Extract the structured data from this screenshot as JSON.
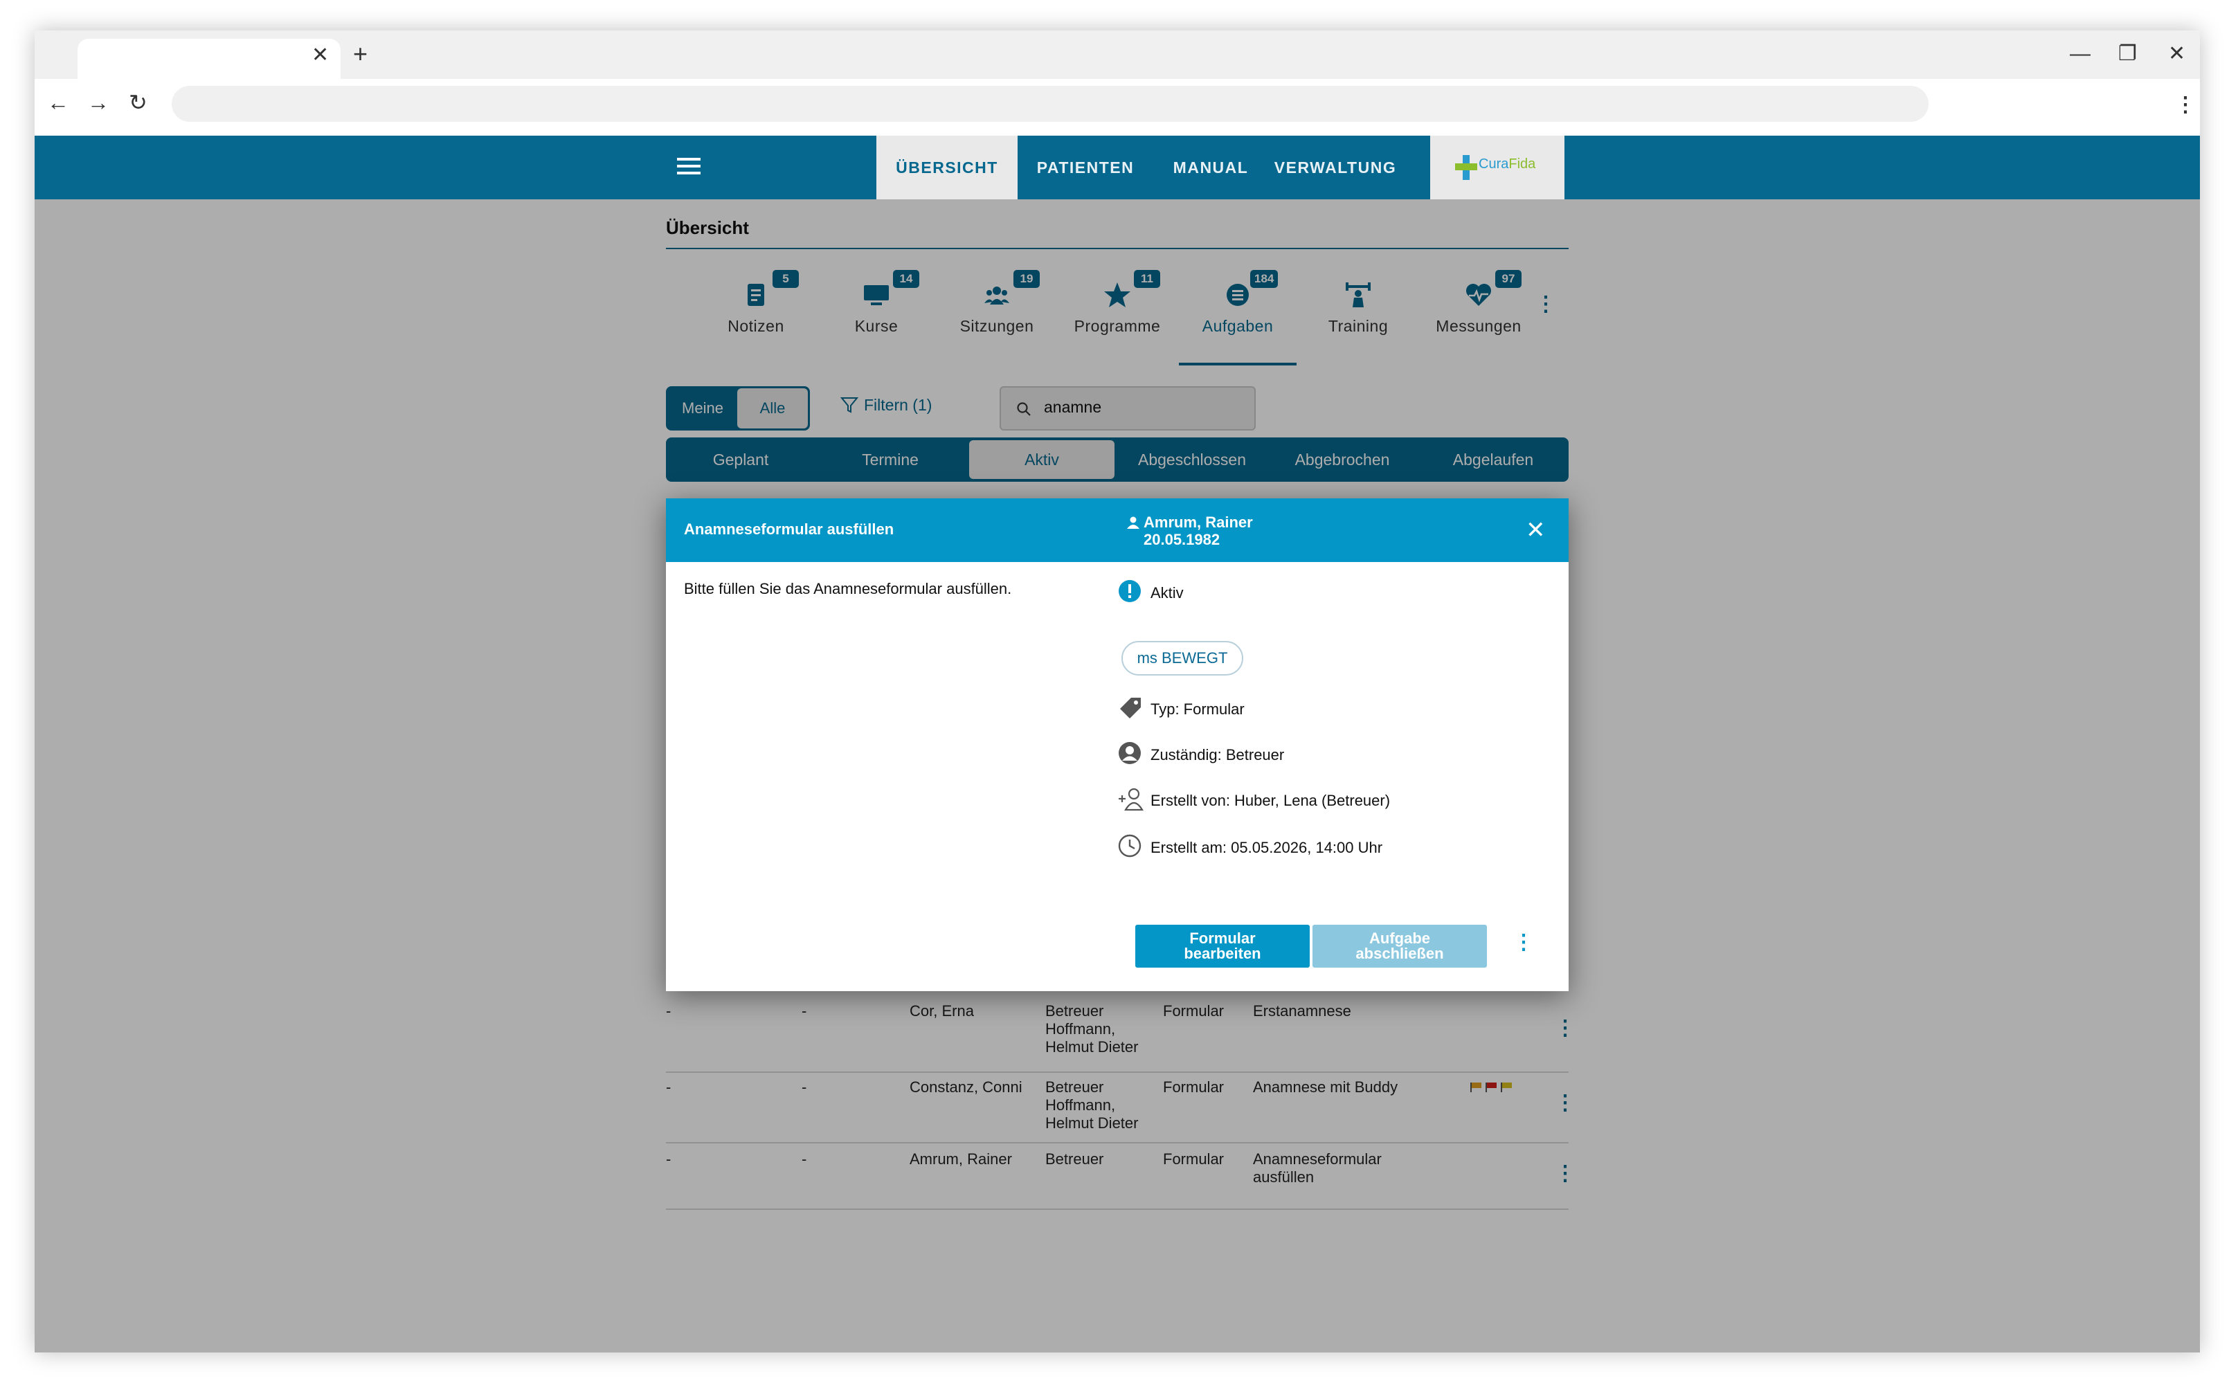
{
  "nav": {
    "items": [
      "ÜBERSICHT",
      "PATIENTEN",
      "MANUAL",
      "VERWALTUNG"
    ],
    "logo": {
      "part1": "Cura",
      "part2": "Fida"
    }
  },
  "page": {
    "title": "Übersicht"
  },
  "category_tabs": [
    {
      "label": "Notizen",
      "count": "5",
      "icon": "note-icon"
    },
    {
      "label": "Kurse",
      "count": "14",
      "icon": "monitor-icon"
    },
    {
      "label": "Sitzungen",
      "count": "19",
      "icon": "group-icon"
    },
    {
      "label": "Programme",
      "count": "11",
      "icon": "star-icon"
    },
    {
      "label": "Aufgaben",
      "count": "184",
      "icon": "list-icon"
    },
    {
      "label": "Training",
      "count": "",
      "icon": "weights-icon"
    },
    {
      "label": "Messungen",
      "count": "97",
      "icon": "heart-pulse-icon"
    }
  ],
  "filters": {
    "scope_mine": "Meine",
    "scope_all": "Alle",
    "filter_label": "Filtern (1)",
    "search_value": "anamne"
  },
  "status_tabs": [
    "Geplant",
    "Termine",
    "Aktiv",
    "Abgeschlossen",
    "Abgebrochen",
    "Abgelaufen"
  ],
  "table_rows": [
    {
      "c1": "-",
      "c2": "-",
      "patient": "Cor, Erna",
      "role": "Betreuer",
      "assignee": "Hoffmann, Helmut Dieter",
      "type": "Formular",
      "task": "Erstanamnese"
    },
    {
      "c1": "-",
      "c2": "-",
      "patient": "Constanz, Conni",
      "role": "Betreuer",
      "assignee": "Hoffmann, Helmut Dieter",
      "type": "Formular",
      "task": "Anamnese mit Buddy"
    },
    {
      "c1": "-",
      "c2": "-",
      "patient": "Amrum, Rainer",
      "role": "Betreuer",
      "assignee": "",
      "type": "Formular",
      "task": "Anamneseformular ausfüllen"
    }
  ],
  "dialog": {
    "title": "Anamneseformular ausfüllen",
    "person_name": "Amrum, Rainer",
    "person_dob": "20.05.1982",
    "description": "Bitte füllen Sie das Anamneseformular ausfüllen.",
    "status": "Aktiv",
    "chip": "ms BEWEGT",
    "type": "Typ: Formular",
    "responsible": "Zuständig: Betreuer",
    "created_by": "Erstellt von: Huber, Lena (Betreuer)",
    "created_at": "Erstellt am: 05.05.2026, 14:00 Uhr",
    "btn_edit_line1": "Formular",
    "btn_edit_line2": "bearbeiten",
    "btn_close_line1": "Aufgabe",
    "btn_close_line2": "abschließen"
  },
  "colors": {
    "appbar": "#06688e",
    "dialog_header": "#0396c7",
    "accent_green": "#8bbd2c"
  }
}
